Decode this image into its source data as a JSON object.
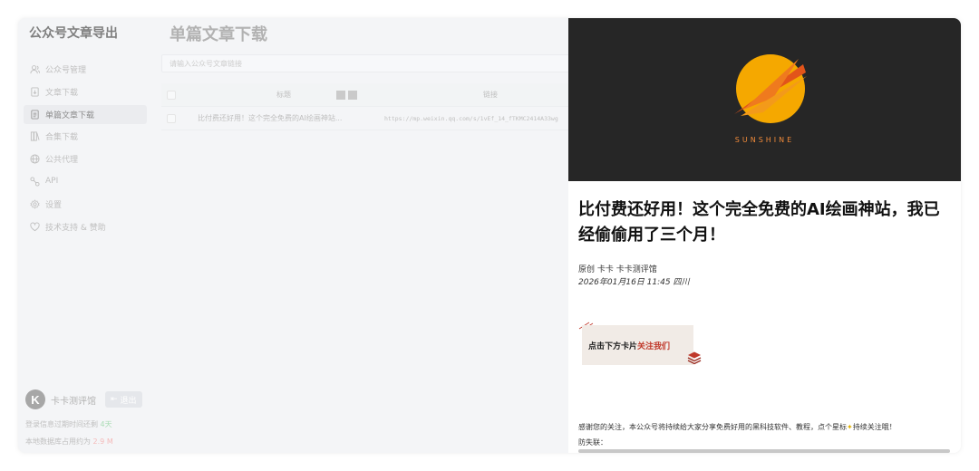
{
  "sidebar": {
    "app_title": "公众号文章导出",
    "items": [
      {
        "label": "公众号管理",
        "icon": "users-icon"
      },
      {
        "label": "文章下载",
        "icon": "document-download-icon"
      },
      {
        "label": "单篇文章下载",
        "icon": "document-icon",
        "active": true
      },
      {
        "label": "合集下载",
        "icon": "collection-icon"
      },
      {
        "label": "公共代理",
        "icon": "globe-icon"
      },
      {
        "label": "API",
        "icon": "api-icon"
      },
      {
        "label": "设置",
        "icon": "gear-icon"
      },
      {
        "label": "技术支持 & 赞助",
        "icon": "heart-icon"
      }
    ],
    "user": {
      "avatar_letter": "K",
      "name": "卡卡测评馆",
      "logout_label": "退出"
    },
    "login_expiry_prefix": "登录信息过期时间还剩",
    "login_expiry_value": "4天",
    "db_size_prefix": "本地数据库占用约为",
    "db_size_value": "2.9 M"
  },
  "main": {
    "title": "单篇文章下载",
    "search_placeholder": "请输入公众号文章链接",
    "table": {
      "headers": {
        "title": "标题",
        "link": "链接"
      },
      "rows": [
        {
          "title": "比付费还好用！这个完全免费的AI绘画神站...",
          "link": "https://mp.weixin.qq.com/s/1vEf_14_fTKMC2414A33wg"
        }
      ]
    }
  },
  "article": {
    "banner_brand": "SUNSHINE",
    "title": "比付费还好用！这个完全免费的AI绘画神站，我已经偷偷用了三个月！",
    "meta_line": "原创 卡卡 卡卡测评馆",
    "date_line": "2026年01月16日 11:45 四川",
    "card_text_plain": "点击下方卡片",
    "card_text_highlight": "关注我们",
    "paragraph_before": "感谢您的关注，本公众号将持续给大家分享免费好用的黑科技软件、教程，点个星标",
    "paragraph_after": "持续关注哦！",
    "paragraph2": "防失联："
  },
  "colors": {
    "sun_orange": "#f5a800",
    "banner_bg": "#262626",
    "highlight_red": "#c0392b"
  }
}
